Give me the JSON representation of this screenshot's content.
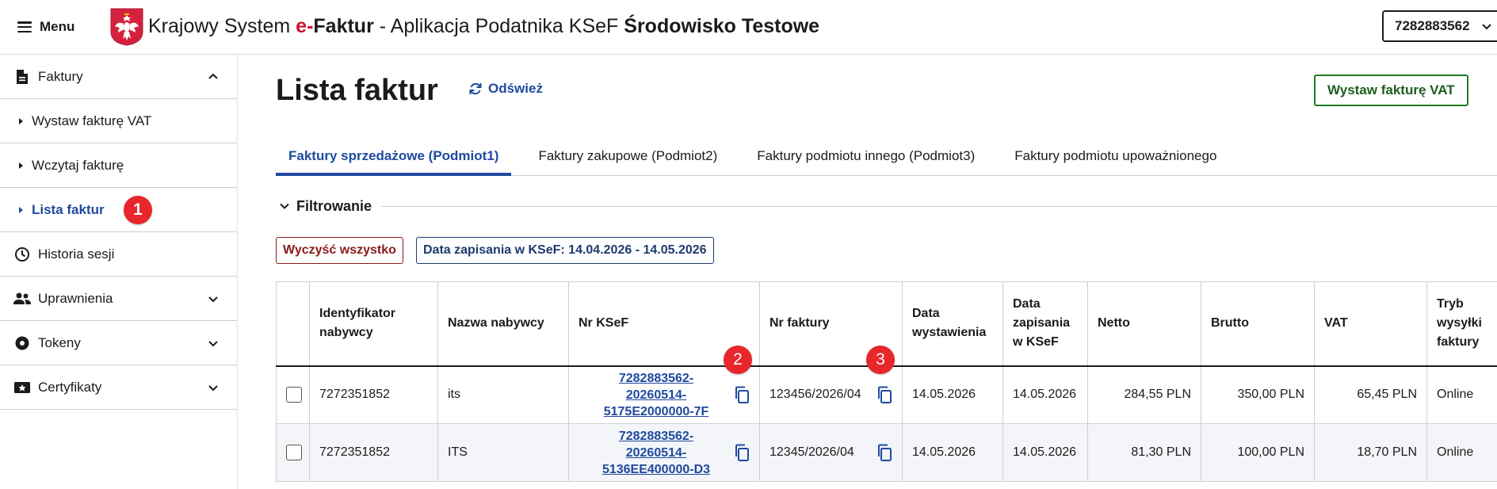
{
  "header": {
    "menu_label": "Menu",
    "title_prefix": "Krajowy System ",
    "title_brand_e": "e-",
    "title_brand_rest": "Faktur",
    "title_middle": " - Aplikacja Podatnika KSeF ",
    "title_env": "Środowisko Testowe",
    "nip_value": "7282883562"
  },
  "sidebar": {
    "items": [
      {
        "label": "Faktury",
        "icon": "document-icon"
      },
      {
        "label": "Wystaw fakturę VAT"
      },
      {
        "label": "Wczytaj fakturę"
      },
      {
        "label": "Lista faktur"
      },
      {
        "label": "Historia sesji",
        "icon": "clock-icon"
      },
      {
        "label": "Uprawnienia",
        "icon": "people-icon"
      },
      {
        "label": "Tokeny",
        "icon": "token-icon"
      },
      {
        "label": "Certyfikaty",
        "icon": "certificate-icon"
      }
    ]
  },
  "markers": [
    "1",
    "2",
    "3"
  ],
  "main": {
    "title": "Lista faktur",
    "refresh_label": "Odśwież",
    "issue_label": "Wystaw fakturę VAT",
    "tabs": [
      {
        "label": "Faktury sprzedażowe (Podmiot1)"
      },
      {
        "label": "Faktury zakupowe (Podmiot2)"
      },
      {
        "label": "Faktury podmiotu innego (Podmiot3)"
      },
      {
        "label": "Faktury podmiotu upoważnionego"
      }
    ],
    "filter_label": "Filtrowanie",
    "clear_label": "Wyczyść wszystko",
    "date_chip": "Data zapisania w KSeF: 14.04.2026 - 14.05.2026"
  },
  "table": {
    "headers": {
      "buyer_id": "Identyfikator nabywcy",
      "buyer_name": "Nazwa nabywcy",
      "ksef_no": "Nr KSeF",
      "invoice_no": "Nr faktury",
      "issue_date": "Data wystawienia",
      "saved_date": "Data zapisania w KSeF",
      "net": "Netto",
      "gross": "Brutto",
      "vat": "VAT",
      "mode": "Tryb wysyłki faktury"
    },
    "rows": [
      {
        "buyer_id": "7272351852",
        "buyer_name": "its",
        "ksef_line1": "7282883562-",
        "ksef_line2": "20260514-",
        "ksef_line3": "5175E2000000-7F",
        "invoice_no": "123456/2026/04",
        "issue_date": "14.05.2026",
        "saved_date": "14.05.2026",
        "net": "284,55 PLN",
        "gross": "350,00 PLN",
        "vat": "65,45 PLN",
        "mode": "Online"
      },
      {
        "buyer_id": "7272351852",
        "buyer_name": "ITS",
        "ksef_line1": "7282883562-",
        "ksef_line2": "20260514-",
        "ksef_line3": "5136EE400000-D3",
        "invoice_no": "12345/2026/04",
        "issue_date": "14.05.2026",
        "saved_date": "14.05.2026",
        "net": "81,30 PLN",
        "gross": "100,00 PLN",
        "vat": "18,70 PLN",
        "mode": "Online"
      }
    ]
  },
  "colors": {
    "accent": "#1e4a9e",
    "marker": "#e8262b",
    "brand_red": "#c8102e",
    "issue_green": "#1e7a1e",
    "clear_red": "#8b1a1a"
  }
}
